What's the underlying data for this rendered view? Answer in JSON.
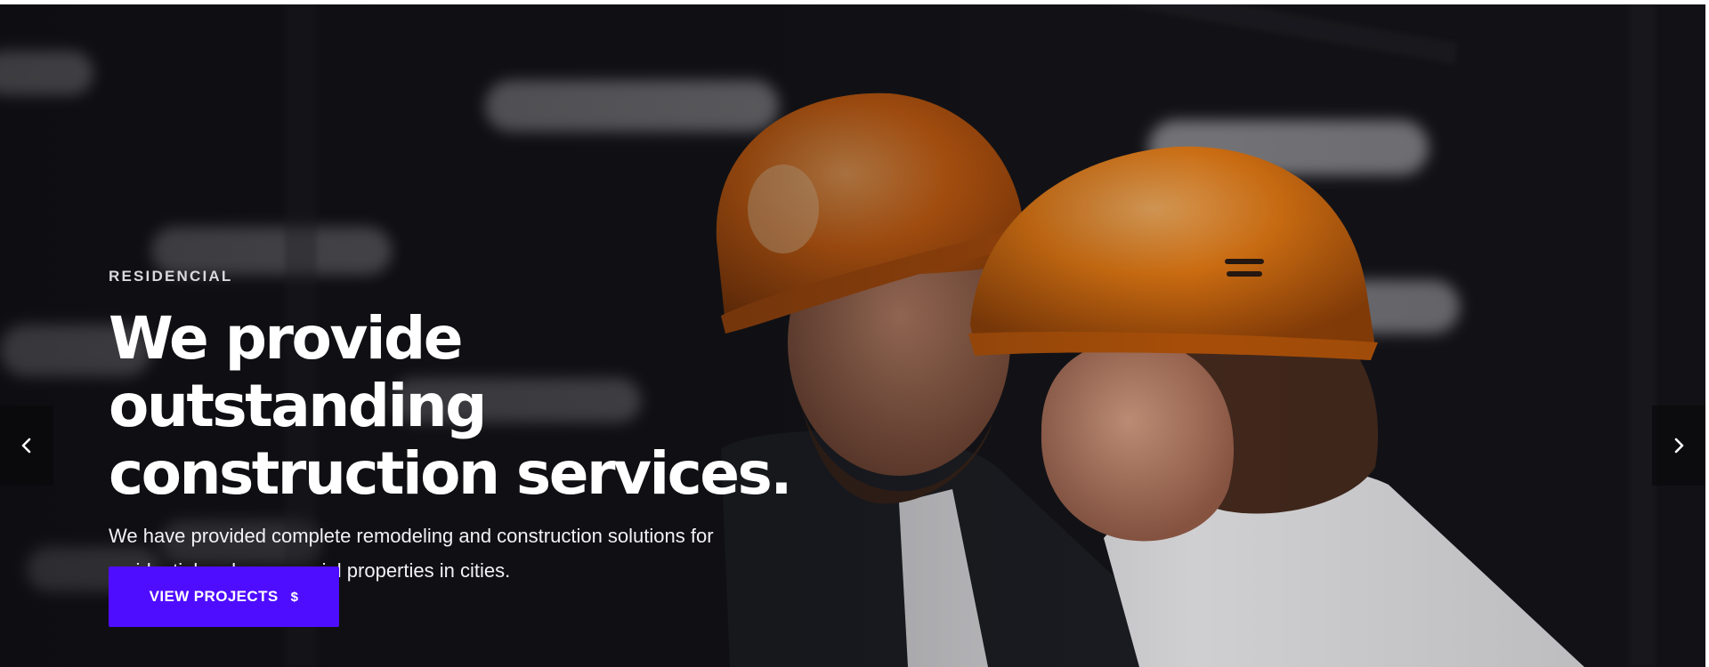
{
  "slider": {
    "eyebrow": "RESIDENCIAL",
    "headline_line1": "We provide outstanding",
    "headline_line2": "construction services.",
    "description": "We have provided complete remodeling and construction solutions for residential and commercial properties in cities.",
    "cta_label": "VIEW PROJECTS",
    "cta_icon": "$",
    "prev_icon": "chevron-left-icon",
    "next_icon": "chevron-right-icon"
  },
  "colors": {
    "accent": "#4f0dff",
    "helmet": "#e8720e",
    "background": "#121216",
    "text": "#ffffff"
  }
}
